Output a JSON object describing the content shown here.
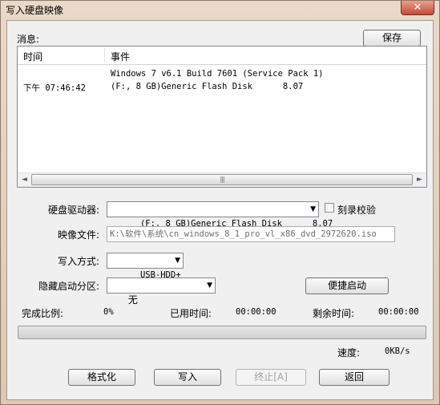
{
  "window": {
    "title": "写入硬盘映像",
    "close_glyph": "✕"
  },
  "messages": {
    "label": "消息:",
    "save_label": "保存",
    "columns": [
      "时间",
      "事件"
    ],
    "rows": [
      {
        "time": "",
        "event": "Windows 7 v6.1 Build 7601 (Service Pack 1)"
      },
      {
        "time": "下午 07:46:42",
        "event": "(F:, 8 GB)Generic Flash Disk      8.07"
      }
    ],
    "scroll_left": "◄",
    "scroll_right": "►",
    "scroll_grip": "|||"
  },
  "form": {
    "drive_label": "硬盘驱动器:",
    "drive_value": "(F:, 8 GB)Generic Flash Disk      8.07",
    "verify_label": "刻录校验",
    "verify_checked": false,
    "image_label": "映像文件:",
    "image_value": "K:\\软件\\系统\\cn_windows_8_1_pro_vl_x86_dvd_2972620.iso",
    "write_mode_label": "写入方式:",
    "write_mode_value": "USB-HDD+",
    "hidden_partition_label": "隐藏启动分区:",
    "hidden_partition_value": "无",
    "quick_boot_label": "便捷启动",
    "dropdown_glyph": "▼"
  },
  "progress": {
    "complete_label": "完成比例:",
    "complete_value": "0%",
    "elapsed_label": "已用时间:",
    "elapsed_value": "00:00:00",
    "remaining_label": "剩余时间:",
    "remaining_value": "00:00:00",
    "fraction": 0,
    "speed_label": "速度:",
    "speed_value": "0KB/s"
  },
  "buttons": {
    "format": "格式化",
    "write": "写入",
    "abort": "终止[A]",
    "back": "返回"
  }
}
